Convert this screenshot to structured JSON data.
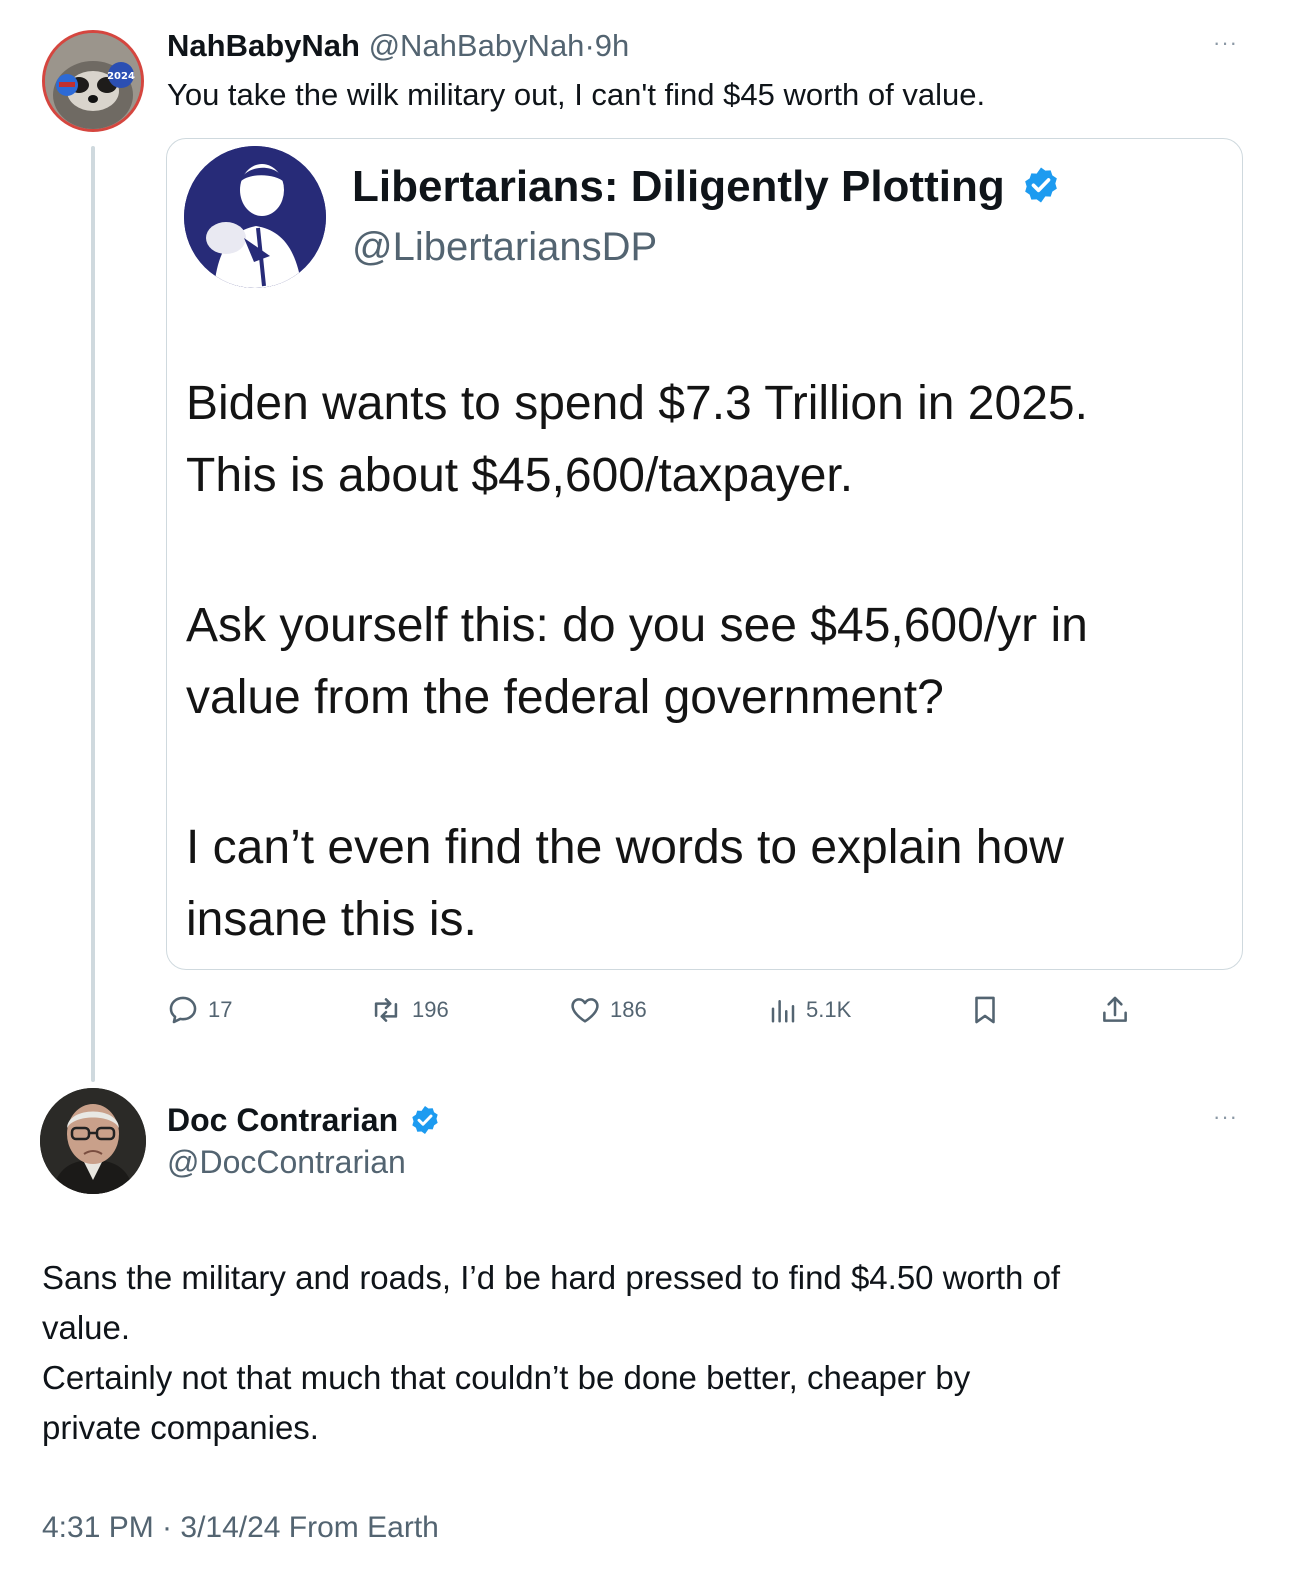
{
  "tweet1": {
    "display_name": "NahBabyNah",
    "handle": "@NahBabyNah",
    "separator": "·",
    "time": "9h",
    "more": "···",
    "text": "You take the wilk military out, I can't find $45 worth of value.",
    "avatar_badge": "2024"
  },
  "quote": {
    "display_name": "Libertarians: Diligently Plotting",
    "handle": "@LibertariansDP",
    "lines": [
      "Biden wants to spend $7.3 Trillion in 2025.",
      "This is about $45,600/taxpayer.",
      "Ask yourself this: do you see $45,600/yr in",
      "value from the federal government?",
      "I can’t even find the words to explain how",
      "insane this is."
    ]
  },
  "actions": {
    "replies": "17",
    "reposts": "196",
    "likes": "186",
    "views": "5.1K"
  },
  "tweet2": {
    "display_name": "Doc Contrarian",
    "handle": "@DocContrarian",
    "more": "···",
    "lines": [
      "Sans the military and roads, I’d be hard pressed to find $4.50 worth of",
      "value.",
      "Certainly not that much that couldn’t be done better, cheaper by",
      "private companies."
    ],
    "meta": "4:31 PM · 3/14/24 From Earth"
  },
  "colors": {
    "verified": "#1d9bf0",
    "secondary_text": "#536471",
    "border": "#cfd9de"
  }
}
